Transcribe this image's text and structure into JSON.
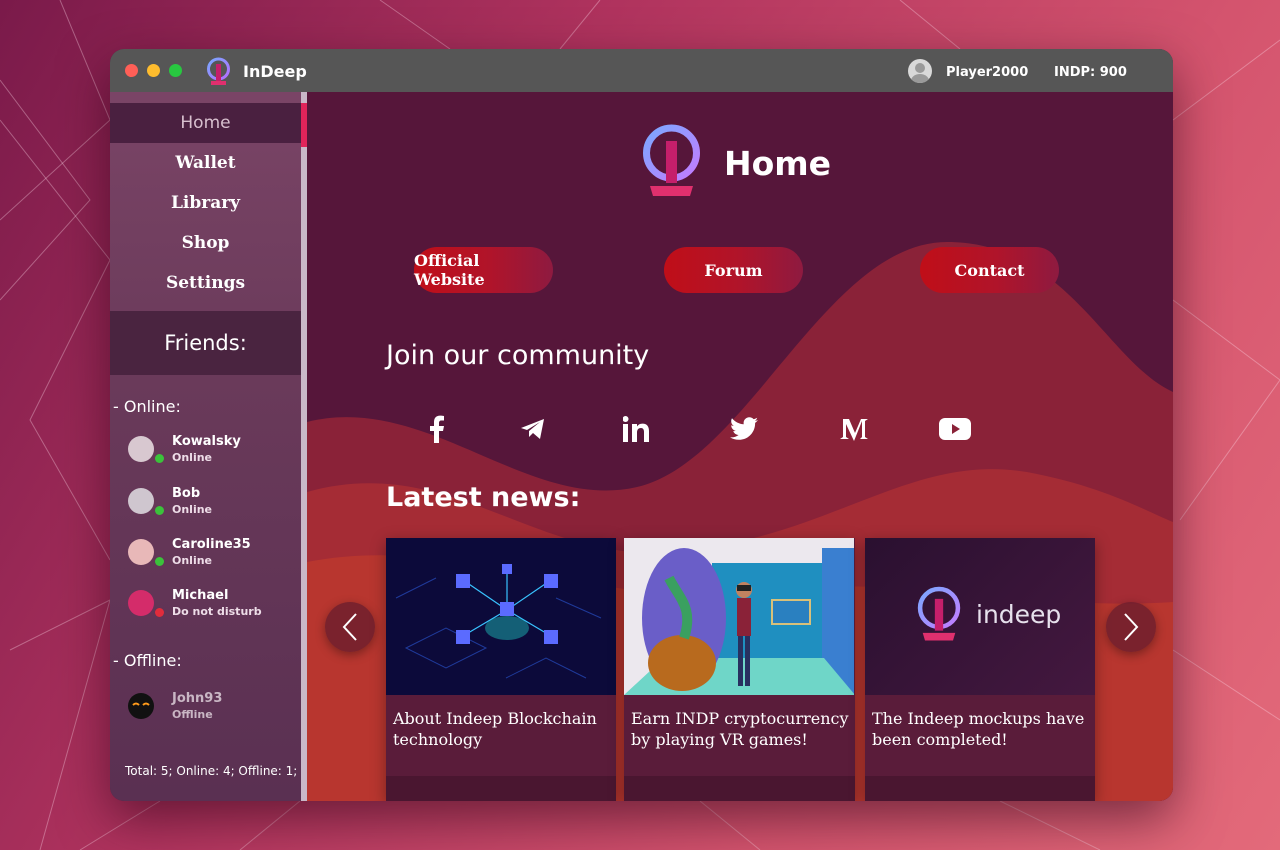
{
  "app": {
    "title": "InDeep",
    "username": "Player2000",
    "balance": "INDP: 900"
  },
  "sidebar": {
    "items": [
      {
        "label": "Home",
        "active": true
      },
      {
        "label": "Wallet"
      },
      {
        "label": "Library"
      },
      {
        "label": "Shop"
      },
      {
        "label": "Settings"
      }
    ],
    "friends_title": "Friends:",
    "online_label": "- Online:",
    "offline_label": "- Offline:",
    "online": [
      {
        "name": "Kowalsky",
        "status": "Online"
      },
      {
        "name": "Bob",
        "status": "Online"
      },
      {
        "name": "Caroline35",
        "status": "Online"
      },
      {
        "name": "Michael",
        "status": "Do not disturb"
      }
    ],
    "offline": [
      {
        "name": "John93",
        "status": "Offline"
      }
    ],
    "total": "Total: 5; Online: 4; Offline: 1;"
  },
  "main": {
    "title": "Home",
    "links": [
      "Official Website",
      "Forum",
      "Contact"
    ],
    "community_title": "Join our community",
    "socials": [
      "facebook-icon",
      "telegram-icon",
      "linkedin-icon",
      "twitter-icon",
      "medium-icon",
      "youtube-icon"
    ],
    "news_title": "Latest news:",
    "news": [
      {
        "title": "About Indeep Blockchain technology"
      },
      {
        "title": "Earn INDP cryptocurrency by playing VR games!"
      },
      {
        "title": "The Indeep mockups have been completed!",
        "image_text": "indeep"
      }
    ]
  },
  "colors": {
    "accent": "#e0245a",
    "button": "#c00e18",
    "online": "#3bc23b",
    "dnd": "#e02c3c"
  }
}
